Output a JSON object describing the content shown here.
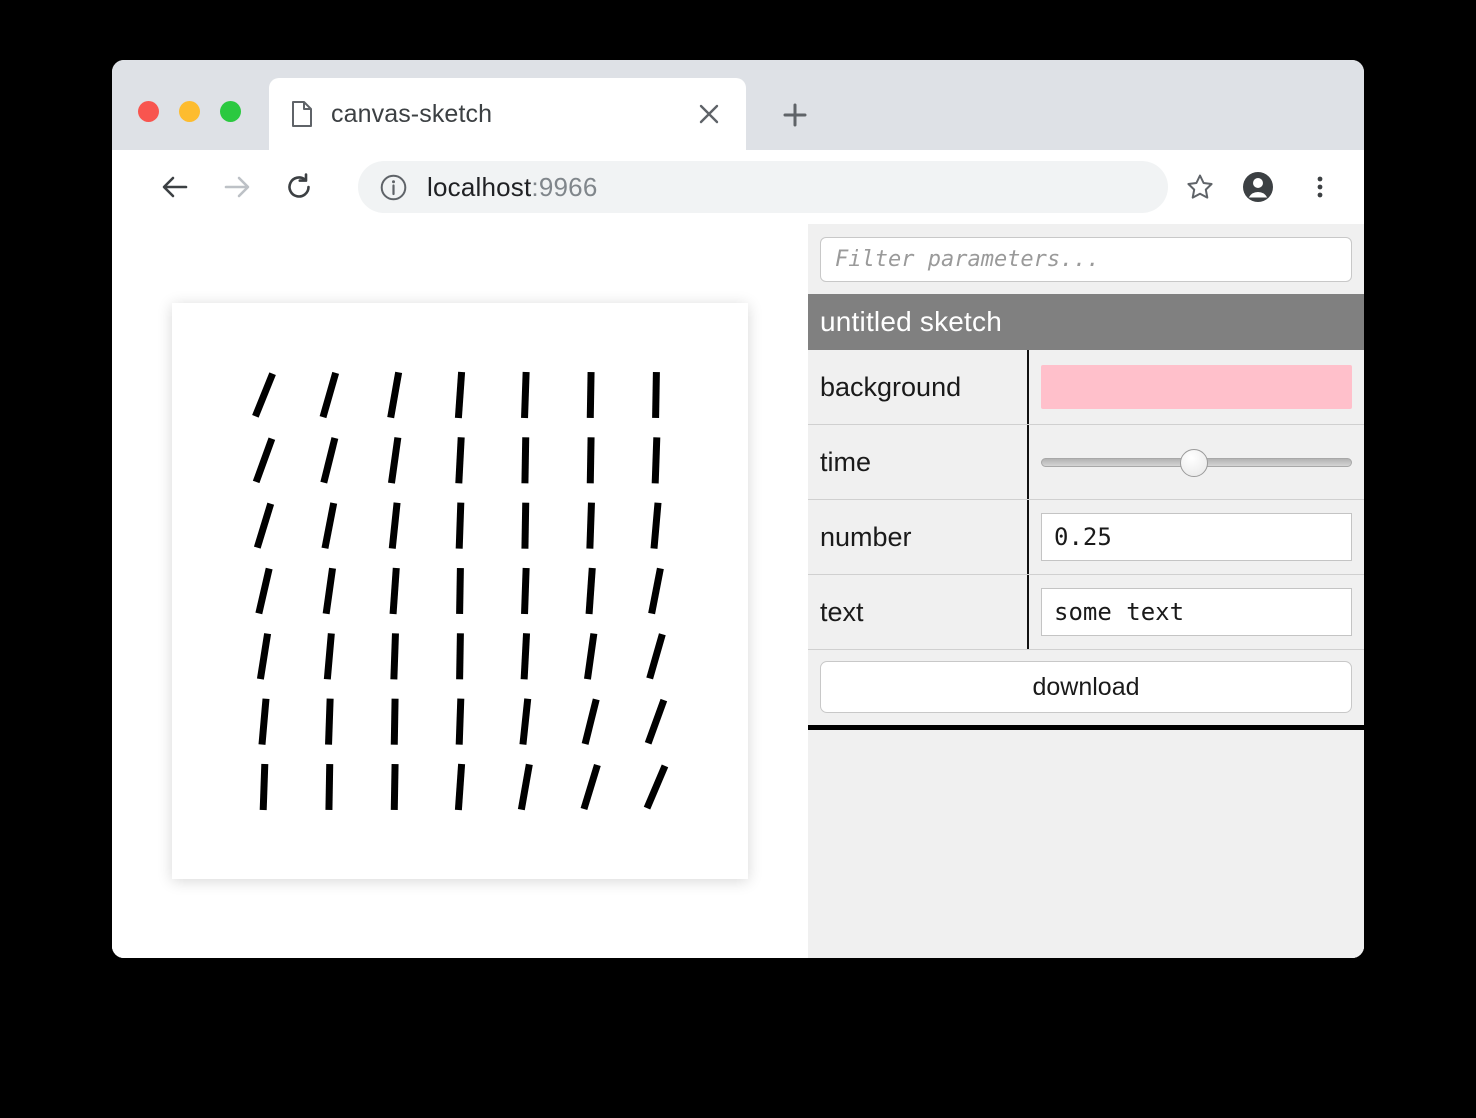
{
  "window": {
    "traffic_lights": [
      {
        "name": "close",
        "color": "#f8554f"
      },
      {
        "name": "minimize",
        "color": "#fdbc2f"
      },
      {
        "name": "zoom",
        "color": "#2bc940"
      }
    ]
  },
  "tab": {
    "title": "canvas-sketch",
    "favicon": "page-icon",
    "close_label": "×",
    "newtab_label": "+"
  },
  "toolbar": {
    "back_label": "←",
    "forward_label": "→",
    "reload_label": "↻",
    "url_host": "localhost",
    "url_port": ":9966",
    "info_icon": "info-circle-icon",
    "bookmark_icon": "star-icon",
    "profile_icon": "account-icon",
    "menu_icon": "more-vertical-icon"
  },
  "panel": {
    "filter_placeholder": "Filter parameters...",
    "filter_value": "",
    "header_title": "untitled sketch",
    "header_color": "#808080",
    "rows": [
      {
        "label": "background",
        "type": "color",
        "value": "#ffc0cb"
      },
      {
        "label": "time",
        "type": "slider",
        "value": 49,
        "min": 0,
        "max": 100
      },
      {
        "label": "number",
        "type": "number",
        "value": "0.25"
      },
      {
        "label": "text",
        "type": "text",
        "value": "some text"
      }
    ],
    "download_label": "download"
  },
  "sketch": {
    "background": "#ffffff",
    "stroke_color": "#000000",
    "stroke_width": 7,
    "line_length": 46,
    "grid": 7,
    "margin": 92,
    "angles": [
      [
        22,
        16,
        10,
        4,
        2,
        1,
        1
      ],
      [
        20,
        14,
        8,
        3,
        1,
        1,
        2
      ],
      [
        17,
        11,
        6,
        2,
        1,
        2,
        5
      ],
      [
        13,
        8,
        4,
        1,
        2,
        4,
        11
      ],
      [
        9,
        5,
        2,
        1,
        3,
        8,
        16
      ],
      [
        5,
        2,
        1,
        2,
        6,
        14,
        20
      ],
      [
        2,
        1,
        1,
        4,
        10,
        17,
        23
      ]
    ]
  }
}
